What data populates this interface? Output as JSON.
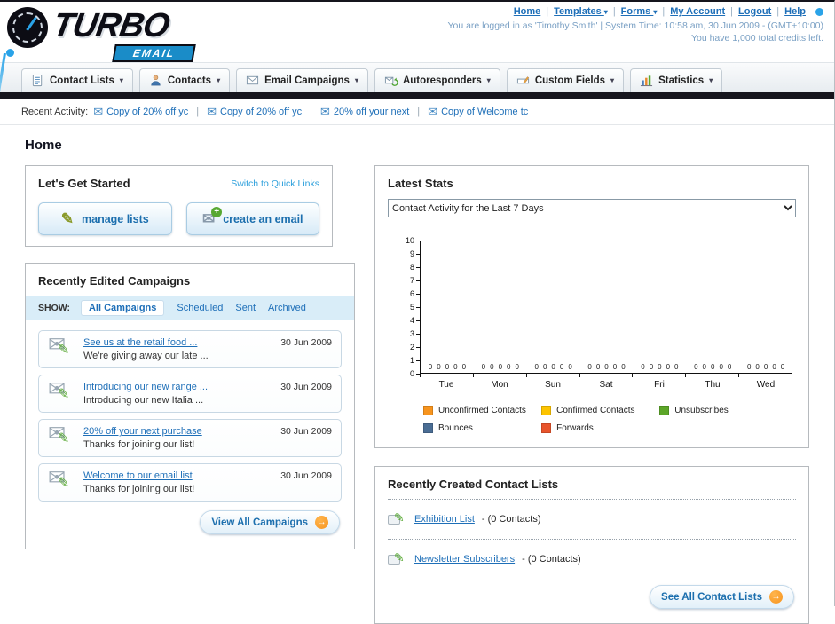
{
  "header": {
    "logo_primary": "TURBO",
    "logo_secondary": "EMAIL",
    "nav_links": [
      {
        "label": "Home",
        "dropdown": false
      },
      {
        "label": "Templates",
        "dropdown": true
      },
      {
        "label": "Forms",
        "dropdown": true
      },
      {
        "label": "My Account",
        "dropdown": false
      },
      {
        "label": "Logout",
        "dropdown": false
      },
      {
        "label": "Help",
        "dropdown": false
      }
    ],
    "login_info": "You are logged in as 'Timothy Smith' | System Time: 10:58 am, 30 Jun 2009 - (GMT+10:00)",
    "credits_info": "You have 1,000 total credits left."
  },
  "nav_tabs": [
    {
      "label": "Contact Lists",
      "icon": "contact-lists-icon"
    },
    {
      "label": "Contacts",
      "icon": "contacts-icon"
    },
    {
      "label": "Email Campaigns",
      "icon": "email-campaigns-icon"
    },
    {
      "label": "Autoresponders",
      "icon": "autoresponders-icon"
    },
    {
      "label": "Custom Fields",
      "icon": "custom-fields-icon"
    },
    {
      "label": "Statistics",
      "icon": "statistics-icon"
    }
  ],
  "recent_activity": {
    "label": "Recent Activity:",
    "items": [
      "Copy of 20% off yc",
      "Copy of 20% off yc",
      "20% off your next",
      "Copy of Welcome tc"
    ]
  },
  "page_title": "Home",
  "get_started": {
    "title": "Let's Get Started",
    "switch_link": "Switch to Quick Links",
    "buttons": [
      {
        "label": "manage lists",
        "icon": "pencil-icon"
      },
      {
        "label": "create an email",
        "icon": "envelope-plus-icon"
      }
    ]
  },
  "campaigns": {
    "title": "Recently Edited Campaigns",
    "show_label": "SHOW:",
    "filters": [
      "All Campaigns",
      "Scheduled",
      "Sent",
      "Archived"
    ],
    "active_filter": "All Campaigns",
    "items": [
      {
        "title": "See us at the retail food ...",
        "subtitle": "We're giving away our late ...",
        "date": "30 Jun 2009"
      },
      {
        "title": "Introducing our new range ...",
        "subtitle": "Introducing our new Italia ...",
        "date": "30 Jun 2009"
      },
      {
        "title": "20% off your next purchase",
        "subtitle": "Thanks for joining our list!",
        "date": "30 Jun 2009"
      },
      {
        "title": "Welcome to our email list",
        "subtitle": "Thanks for joining our list!",
        "date": "30 Jun 2009"
      }
    ],
    "view_all_label": "View All Campaigns"
  },
  "stats": {
    "title": "Latest Stats",
    "dropdown_value": "Contact Activity for the Last 7 Days",
    "chart_data": {
      "type": "bar",
      "categories": [
        "Tue",
        "Mon",
        "Sun",
        "Sat",
        "Fri",
        "Thu",
        "Wed"
      ],
      "series": [
        {
          "name": "Unconfirmed Contacts",
          "color": "#f7941e",
          "values": [
            0,
            0,
            0,
            0,
            0,
            0,
            0
          ]
        },
        {
          "name": "Confirmed Contacts",
          "color": "#fdc400",
          "values": [
            0,
            0,
            0,
            0,
            0,
            0,
            0
          ]
        },
        {
          "name": "Unsubscribes",
          "color": "#5ca628",
          "values": [
            0,
            0,
            0,
            0,
            0,
            0,
            0
          ]
        },
        {
          "name": "Bounces",
          "color": "#4a6d94",
          "values": [
            0,
            0,
            0,
            0,
            0,
            0,
            0
          ]
        },
        {
          "name": "Forwards",
          "color": "#e8542c",
          "values": [
            0,
            0,
            0,
            0,
            0,
            0,
            0
          ]
        }
      ],
      "title": "Contact Activity for the Last 7 Days",
      "xlabel": "",
      "ylabel": "",
      "ylim": [
        0,
        10
      ],
      "grid": false,
      "legend_position": "bottom"
    }
  },
  "contact_lists": {
    "title": "Recently Created Contact Lists",
    "items": [
      {
        "name": "Exhibition List",
        "suffix": "- (0 Contacts)"
      },
      {
        "name": "Newsletter Subscribers",
        "suffix": "- (0 Contacts)"
      }
    ],
    "see_all_label": "See All Contact Lists"
  },
  "colors": {
    "link_blue": "#1e6fb8",
    "accent_orange": "#f7941e",
    "dark_bar": "#15151d",
    "filter_bar_bg": "#d9edf8"
  }
}
